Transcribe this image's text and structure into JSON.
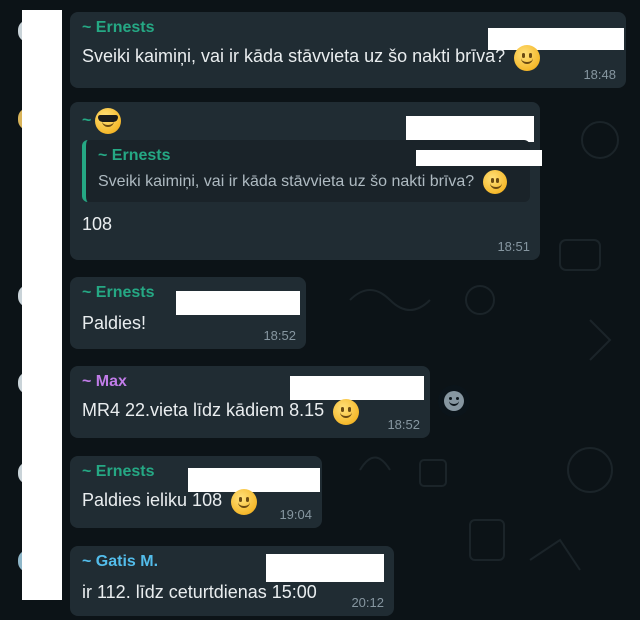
{
  "messages": [
    {
      "sender": "~ Ernests",
      "text": "Sveiki kaimiņi, vai ir kāda stāvvieta uz šo nakti brīva?",
      "time": "18:48"
    },
    {
      "sender": "~",
      "quote_sender": "~ Ernests",
      "quote_text": "Sveiki kaimiņi, vai ir kāda stāvvieta uz šo nakti brīva?",
      "text": "108",
      "time": "18:51"
    },
    {
      "sender": "~ Ernests",
      "text": "Paldies!",
      "time": "18:52"
    },
    {
      "sender": "~ Max",
      "text": "MR4 22.vieta līdz kādiem 8.15",
      "time": "18:52"
    },
    {
      "sender": "~ Ernests",
      "text": "Paldies ieliku 108",
      "time": "19:04"
    },
    {
      "sender": "~ Gatis M.",
      "text": "ir 112. līdz ceturtdienas 15:00",
      "time": "20:12"
    }
  ],
  "colors": {
    "background": "#0c1317",
    "bubble": "#202c33",
    "sender_green": "#25a884",
    "sender_purple": "#c07ce8",
    "sender_blue": "#53bdeb"
  },
  "icons": {
    "emoji_smile": "slightly-smiling-face-emoji",
    "emoji_cool": "smiling-face-with-sunglasses-emoji",
    "reaction": "add-reaction-icon"
  }
}
